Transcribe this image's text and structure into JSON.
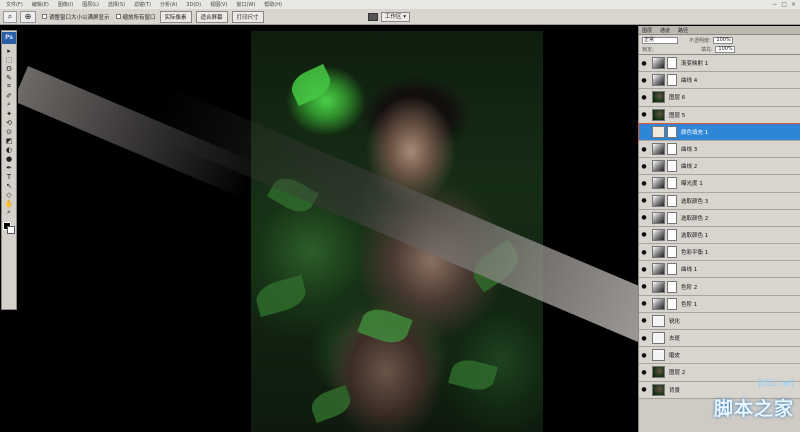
{
  "menubar": {
    "items": [
      "文件(F)",
      "编辑(E)",
      "图像(I)",
      "图层(L)",
      "选择(S)",
      "滤镜(T)",
      "分析(A)",
      "3D(D)",
      "视图(V)",
      "窗口(W)",
      "帮助(H)"
    ],
    "window_buttons": [
      "−",
      "□",
      "×"
    ]
  },
  "options_bar": {
    "tool_icon": "zoom-tool",
    "resize_windows_label": "调整窗口大小以满屏显示",
    "zoom_all_windows_label": "缩放所有窗口",
    "actual_pixels_label": "实际像素",
    "fit_screen_label": "适合屏幕",
    "print_size_label": "打印尺寸",
    "workspace_label": "工作区 ▾"
  },
  "toolbox": {
    "logo": "Ps",
    "tools": [
      "▸",
      "⬚",
      "ʘ",
      "✎",
      "⌗",
      "✐",
      "⌕",
      "✦",
      "⟲",
      "⊙",
      "◩",
      "◐",
      "●",
      "✒",
      "T",
      "↖",
      "◇",
      "✋",
      "⌕"
    ]
  },
  "layers_panel": {
    "tabs": [
      "图层",
      "通道",
      "路径"
    ],
    "blend_mode": "正常",
    "opacity_label": "不透明度:",
    "opacity_value": "100%",
    "lock_label": "锁定:",
    "fill_label": "填充:",
    "fill_value": "100%",
    "layers": [
      {
        "name": "渐变映射 1",
        "visible": true,
        "thumb": "adj",
        "mask": "white",
        "selected": false
      },
      {
        "name": "曲线 4",
        "visible": true,
        "thumb": "adj",
        "mask": "black",
        "selected": false
      },
      {
        "name": "图层 6",
        "visible": true,
        "thumb": "photo",
        "mask": "",
        "selected": false
      },
      {
        "name": "图层 5",
        "visible": true,
        "thumb": "photo",
        "mask": "",
        "selected": false
      },
      {
        "name": "颜色填充 1",
        "visible": false,
        "thumb": "fill",
        "mask": "blob",
        "selected": true
      },
      {
        "name": "曲线 3",
        "visible": true,
        "thumb": "adj",
        "mask": "blob",
        "selected": false
      },
      {
        "name": "曲线 2",
        "visible": true,
        "thumb": "adj",
        "mask": "white",
        "selected": false
      },
      {
        "name": "曝光度 1",
        "visible": true,
        "thumb": "adj",
        "mask": "white",
        "selected": false
      },
      {
        "name": "选取颜色 3",
        "visible": true,
        "thumb": "adj",
        "mask": "white",
        "selected": false
      },
      {
        "name": "选取颜色 2",
        "visible": true,
        "thumb": "adj",
        "mask": "blob",
        "selected": false
      },
      {
        "name": "选取颜色 1",
        "visible": true,
        "thumb": "adj",
        "mask": "blob",
        "selected": false
      },
      {
        "name": "色彩平衡 1",
        "visible": true,
        "thumb": "adj",
        "mask": "blob",
        "selected": false
      },
      {
        "name": "曲线 1",
        "visible": true,
        "thumb": "adj",
        "mask": "blob",
        "selected": false
      },
      {
        "name": "色阶 2",
        "visible": true,
        "thumb": "adj",
        "mask": "white",
        "selected": false
      },
      {
        "name": "色阶 1",
        "visible": true,
        "thumb": "adj",
        "mask": "white",
        "selected": false
      },
      {
        "name": "锐化",
        "visible": true,
        "thumb": "white",
        "mask": "",
        "selected": false
      },
      {
        "name": "去斑",
        "visible": true,
        "thumb": "white",
        "mask": "",
        "selected": false
      },
      {
        "name": "磨皮",
        "visible": true,
        "thumb": "white",
        "mask": "",
        "selected": false
      },
      {
        "name": "图层 2",
        "visible": true,
        "thumb": "photo",
        "mask": "",
        "selected": false
      },
      {
        "name": "背景",
        "visible": true,
        "thumb": "photo",
        "mask": "",
        "selected": false
      }
    ]
  },
  "watermark": {
    "url": "jb51.net",
    "name": "脚本之家"
  }
}
